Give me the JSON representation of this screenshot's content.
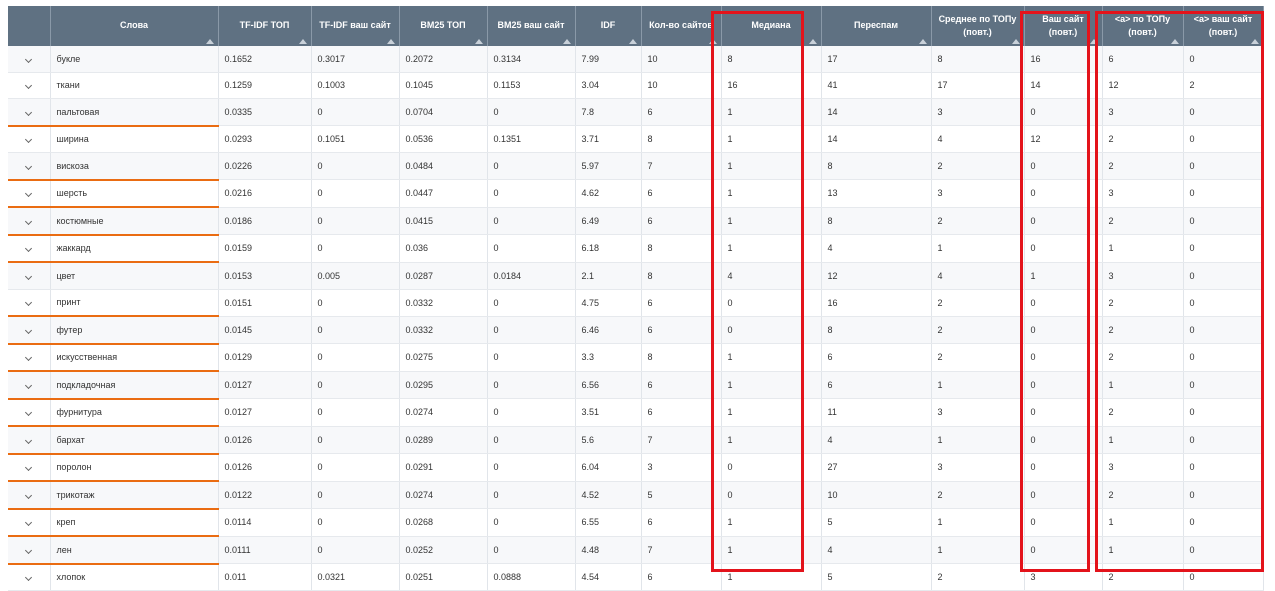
{
  "columns": [
    {
      "label": "",
      "sortable": false
    },
    {
      "label": "Слова",
      "sortable": true
    },
    {
      "label": "TF-IDF ТОП",
      "sortable": true
    },
    {
      "label": "TF-IDF ваш сайт",
      "sortable": true
    },
    {
      "label": "BM25 ТОП",
      "sortable": true
    },
    {
      "label": "BM25 ваш сайт",
      "sortable": true
    },
    {
      "label": "IDF",
      "sortable": true
    },
    {
      "label": "Кол-во сайтов",
      "sortable": true
    },
    {
      "label": "Медиана",
      "sortable": true
    },
    {
      "label": "Переспам",
      "sortable": true
    },
    {
      "label": "Среднее по ТОПу (повт.)",
      "sortable": true
    },
    {
      "label": "Ваш сайт (повт.)",
      "sortable": true
    },
    {
      "label": "<a> по ТОПу (повт.)",
      "sortable": true
    },
    {
      "label": "<a> ваш сайт (повт.)",
      "sortable": true
    }
  ],
  "rows": [
    {
      "cells": [
        "букле",
        "0.1652",
        "0.3017",
        "0.2072",
        "0.3134",
        "7.99",
        "10",
        "8",
        "17",
        "8",
        "16",
        "6",
        "0"
      ],
      "underline": false
    },
    {
      "cells": [
        "ткани",
        "0.1259",
        "0.1003",
        "0.1045",
        "0.1153",
        "3.04",
        "10",
        "16",
        "41",
        "17",
        "14",
        "12",
        "2"
      ],
      "underline": false
    },
    {
      "cells": [
        "пальтовая",
        "0.0335",
        "0",
        "0.0704",
        "0",
        "7.8",
        "6",
        "1",
        "14",
        "3",
        "0",
        "3",
        "0"
      ],
      "underline": true
    },
    {
      "cells": [
        "ширина",
        "0.0293",
        "0.1051",
        "0.0536",
        "0.1351",
        "3.71",
        "8",
        "1",
        "14",
        "4",
        "12",
        "2",
        "0"
      ],
      "underline": false
    },
    {
      "cells": [
        "вискоза",
        "0.0226",
        "0",
        "0.0484",
        "0",
        "5.97",
        "7",
        "1",
        "8",
        "2",
        "0",
        "2",
        "0"
      ],
      "underline": true
    },
    {
      "cells": [
        "шерсть",
        "0.0216",
        "0",
        "0.0447",
        "0",
        "4.62",
        "6",
        "1",
        "13",
        "3",
        "0",
        "3",
        "0"
      ],
      "underline": true
    },
    {
      "cells": [
        "костюмные",
        "0.0186",
        "0",
        "0.0415",
        "0",
        "6.49",
        "6",
        "1",
        "8",
        "2",
        "0",
        "2",
        "0"
      ],
      "underline": true
    },
    {
      "cells": [
        "жаккард",
        "0.0159",
        "0",
        "0.036",
        "0",
        "6.18",
        "8",
        "1",
        "4",
        "1",
        "0",
        "1",
        "0"
      ],
      "underline": true
    },
    {
      "cells": [
        "цвет",
        "0.0153",
        "0.005",
        "0.0287",
        "0.0184",
        "2.1",
        "8",
        "4",
        "12",
        "4",
        "1",
        "3",
        "0"
      ],
      "underline": false
    },
    {
      "cells": [
        "принт",
        "0.0151",
        "0",
        "0.0332",
        "0",
        "4.75",
        "6",
        "0",
        "16",
        "2",
        "0",
        "2",
        "0"
      ],
      "underline": true
    },
    {
      "cells": [
        "футер",
        "0.0145",
        "0",
        "0.0332",
        "0",
        "6.46",
        "6",
        "0",
        "8",
        "2",
        "0",
        "2",
        "0"
      ],
      "underline": true
    },
    {
      "cells": [
        "искусственная",
        "0.0129",
        "0",
        "0.0275",
        "0",
        "3.3",
        "8",
        "1",
        "6",
        "2",
        "0",
        "2",
        "0"
      ],
      "underline": true
    },
    {
      "cells": [
        "подкладочная",
        "0.0127",
        "0",
        "0.0295",
        "0",
        "6.56",
        "6",
        "1",
        "6",
        "1",
        "0",
        "1",
        "0"
      ],
      "underline": true
    },
    {
      "cells": [
        "фурнитура",
        "0.0127",
        "0",
        "0.0274",
        "0",
        "3.51",
        "6",
        "1",
        "11",
        "3",
        "0",
        "2",
        "0"
      ],
      "underline": true
    },
    {
      "cells": [
        "бархат",
        "0.0126",
        "0",
        "0.0289",
        "0",
        "5.6",
        "7",
        "1",
        "4",
        "1",
        "0",
        "1",
        "0"
      ],
      "underline": true
    },
    {
      "cells": [
        "поролон",
        "0.0126",
        "0",
        "0.0291",
        "0",
        "6.04",
        "3",
        "0",
        "27",
        "3",
        "0",
        "3",
        "0"
      ],
      "underline": true
    },
    {
      "cells": [
        "трикотаж",
        "0.0122",
        "0",
        "0.0274",
        "0",
        "4.52",
        "5",
        "0",
        "10",
        "2",
        "0",
        "2",
        "0"
      ],
      "underline": true
    },
    {
      "cells": [
        "креп",
        "0.0114",
        "0",
        "0.0268",
        "0",
        "6.55",
        "6",
        "1",
        "5",
        "1",
        "0",
        "1",
        "0"
      ],
      "underline": true
    },
    {
      "cells": [
        "лен",
        "0.0111",
        "0",
        "0.0252",
        "0",
        "4.48",
        "7",
        "1",
        "4",
        "1",
        "0",
        "1",
        "0"
      ],
      "underline": true
    },
    {
      "cells": [
        "хлопок",
        "0.011",
        "0.0321",
        "0.0251",
        "0.0888",
        "4.54",
        "6",
        "1",
        "5",
        "2",
        "3",
        "2",
        "0"
      ],
      "underline": false
    }
  ],
  "colors": {
    "header": "#5f7182",
    "underline": "#ea6c12",
    "highlight": "#e3131b"
  }
}
